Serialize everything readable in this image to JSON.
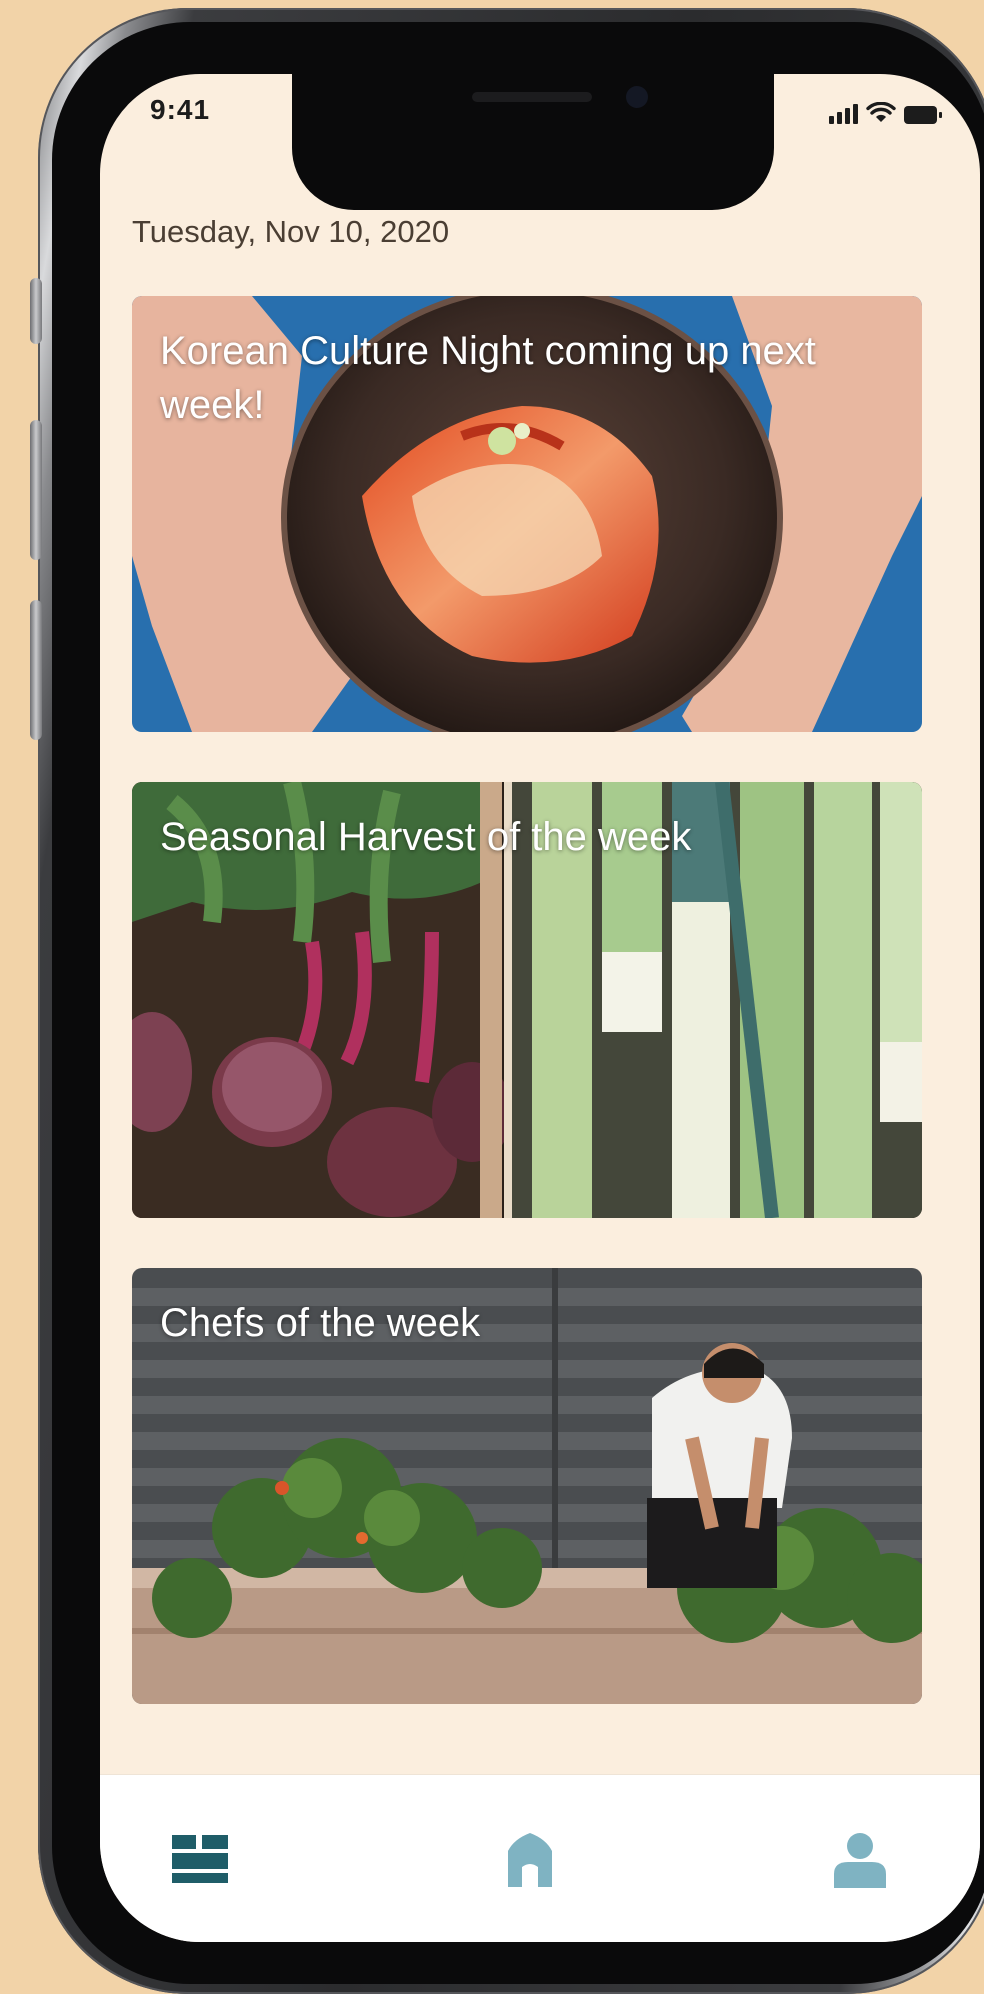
{
  "status_bar": {
    "time": "9:41"
  },
  "feed": {
    "date": "Tuesday, Nov 10, 2020",
    "cards": [
      {
        "title": "Korean Culture Night coming up next week!"
      },
      {
        "title": "Seasonal Harvest of the week"
      },
      {
        "title": "Chefs of the week"
      }
    ]
  },
  "tab_bar": {
    "tabs": [
      {
        "icon": "feed-icon",
        "active": true
      },
      {
        "icon": "home-icon",
        "active": false
      },
      {
        "icon": "profile-icon",
        "active": false
      }
    ]
  },
  "colors": {
    "background": "#f2d3a8",
    "screen": "#fbeede",
    "active_tab": "#1f5d68",
    "inactive_tab": "#7fb3c2"
  }
}
